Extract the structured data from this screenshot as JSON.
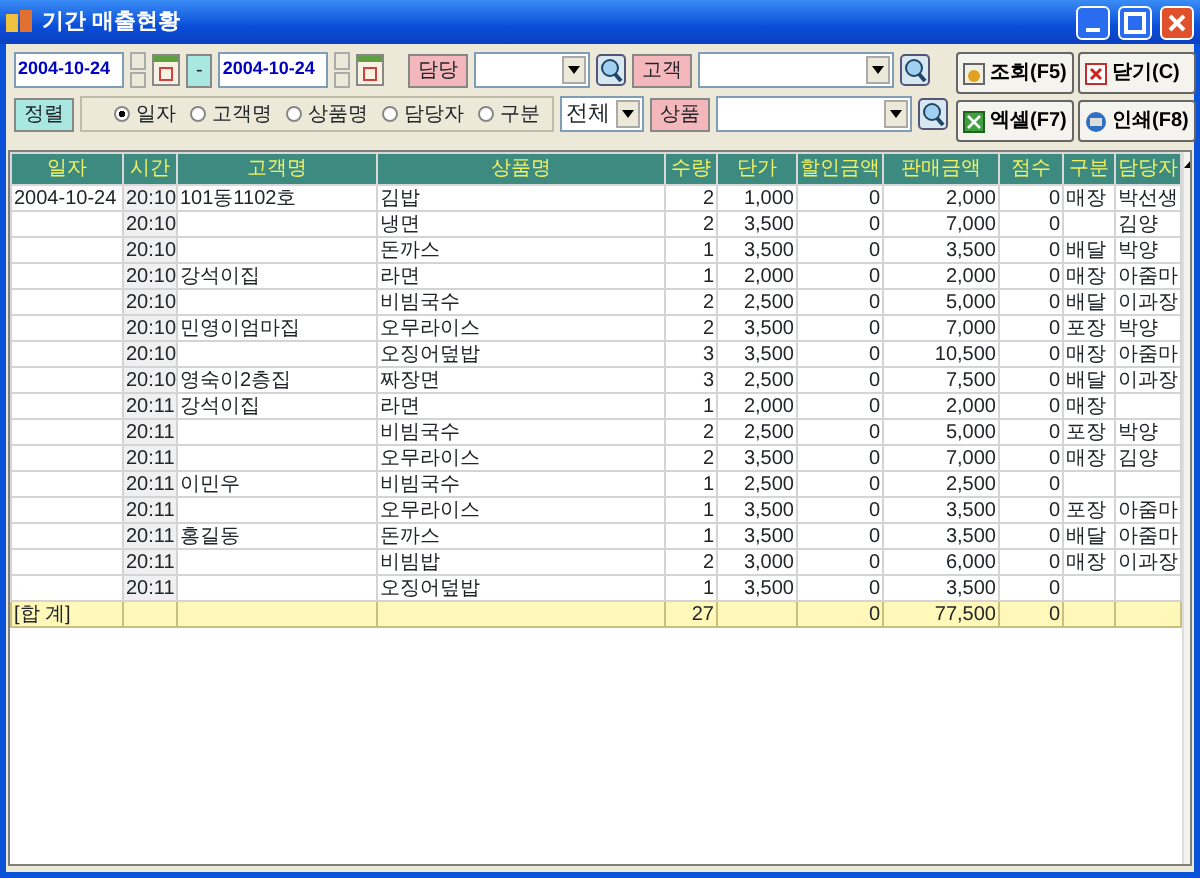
{
  "window": {
    "title": "기간 매출현황"
  },
  "filters": {
    "date_from": "2004-10-24",
    "separator": "-",
    "date_to": "2004-10-24",
    "staff_label": "담당",
    "customer_label": "고객",
    "sort_label": "정렬",
    "category_value": "전체",
    "product_label": "상품"
  },
  "sort_options": [
    {
      "label": "일자",
      "selected": true
    },
    {
      "label": "고객명",
      "selected": false
    },
    {
      "label": "상품명",
      "selected": false
    },
    {
      "label": "담당자",
      "selected": false
    },
    {
      "label": "구분",
      "selected": false
    }
  ],
  "buttons": [
    {
      "kind": "search",
      "label": "조회(F5)"
    },
    {
      "kind": "close",
      "label": "닫기(C)"
    },
    {
      "kind": "excel",
      "label": "엑셀(F7)"
    },
    {
      "kind": "print",
      "label": "인쇄(F8)"
    }
  ],
  "table": {
    "columns": [
      "일자",
      "시간",
      "고객명",
      "상품명",
      "수량",
      "단가",
      "할인금액",
      "판매금액",
      "점수",
      "구분",
      "담당자"
    ],
    "rows": [
      {
        "date": "2004-10-24",
        "time": "20:10",
        "customer": "101동1102호",
        "product": "김밥",
        "qty": "2",
        "price": "1,000",
        "discount": "0",
        "amount": "2,000",
        "points": "0",
        "type": "매장",
        "staff": "박선생"
      },
      {
        "time": "20:10",
        "product": "냉면",
        "qty": "2",
        "price": "3,500",
        "discount": "0",
        "amount": "7,000",
        "points": "0",
        "staff": "김양"
      },
      {
        "time": "20:10",
        "product": "돈까스",
        "qty": "1",
        "price": "3,500",
        "discount": "0",
        "amount": "3,500",
        "points": "0",
        "type": "배달",
        "staff": "박양"
      },
      {
        "time": "20:10",
        "customer": "강석이집",
        "product": "라면",
        "qty": "1",
        "price": "2,000",
        "discount": "0",
        "amount": "2,000",
        "points": "0",
        "type": "매장",
        "staff": "아줌마"
      },
      {
        "time": "20:10",
        "product": "비빔국수",
        "qty": "2",
        "price": "2,500",
        "discount": "0",
        "amount": "5,000",
        "points": "0",
        "type": "배달",
        "staff": "이과장"
      },
      {
        "time": "20:10",
        "customer": "민영이엄마집",
        "product": "오무라이스",
        "qty": "2",
        "price": "3,500",
        "discount": "0",
        "amount": "7,000",
        "points": "0",
        "type": "포장",
        "staff": "박양"
      },
      {
        "time": "20:10",
        "product": "오징어덮밥",
        "qty": "3",
        "price": "3,500",
        "discount": "0",
        "amount": "10,500",
        "points": "0",
        "type": "매장",
        "staff": "아줌마"
      },
      {
        "time": "20:10",
        "customer": "영숙이2층집",
        "product": "짜장면",
        "qty": "3",
        "price": "2,500",
        "discount": "0",
        "amount": "7,500",
        "points": "0",
        "type": "배달",
        "staff": "이과장"
      },
      {
        "time": "20:11",
        "customer": "강석이집",
        "product": "라면",
        "qty": "1",
        "price": "2,000",
        "discount": "0",
        "amount": "2,000",
        "points": "0",
        "type": "매장"
      },
      {
        "time": "20:11",
        "product": "비빔국수",
        "qty": "2",
        "price": "2,500",
        "discount": "0",
        "amount": "5,000",
        "points": "0",
        "type": "포장",
        "staff": "박양"
      },
      {
        "time": "20:11",
        "product": "오무라이스",
        "qty": "2",
        "price": "3,500",
        "discount": "0",
        "amount": "7,000",
        "points": "0",
        "type": "매장",
        "staff": "김양"
      },
      {
        "time": "20:11",
        "customer": "이민우",
        "product": "비빔국수",
        "qty": "1",
        "price": "2,500",
        "discount": "0",
        "amount": "2,500",
        "points": "0"
      },
      {
        "time": "20:11",
        "product": "오무라이스",
        "qty": "1",
        "price": "3,500",
        "discount": "0",
        "amount": "3,500",
        "points": "0",
        "type": "포장",
        "staff": "아줌마"
      },
      {
        "time": "20:11",
        "customer": "홍길동",
        "product": "돈까스",
        "qty": "1",
        "price": "3,500",
        "discount": "0",
        "amount": "3,500",
        "points": "0",
        "type": "배달",
        "staff": "아줌마"
      },
      {
        "time": "20:11",
        "product": "비빔밥",
        "qty": "2",
        "price": "3,000",
        "discount": "0",
        "amount": "6,000",
        "points": "0",
        "type": "매장",
        "staff": "이과장"
      },
      {
        "time": "20:11",
        "product": "오징어덮밥",
        "qty": "1",
        "price": "3,500",
        "discount": "0",
        "amount": "3,500",
        "points": "0"
      }
    ],
    "total": {
      "label": "[합 계]",
      "qty": "27",
      "discount": "0",
      "amount": "77,500",
      "points": "0"
    }
  }
}
